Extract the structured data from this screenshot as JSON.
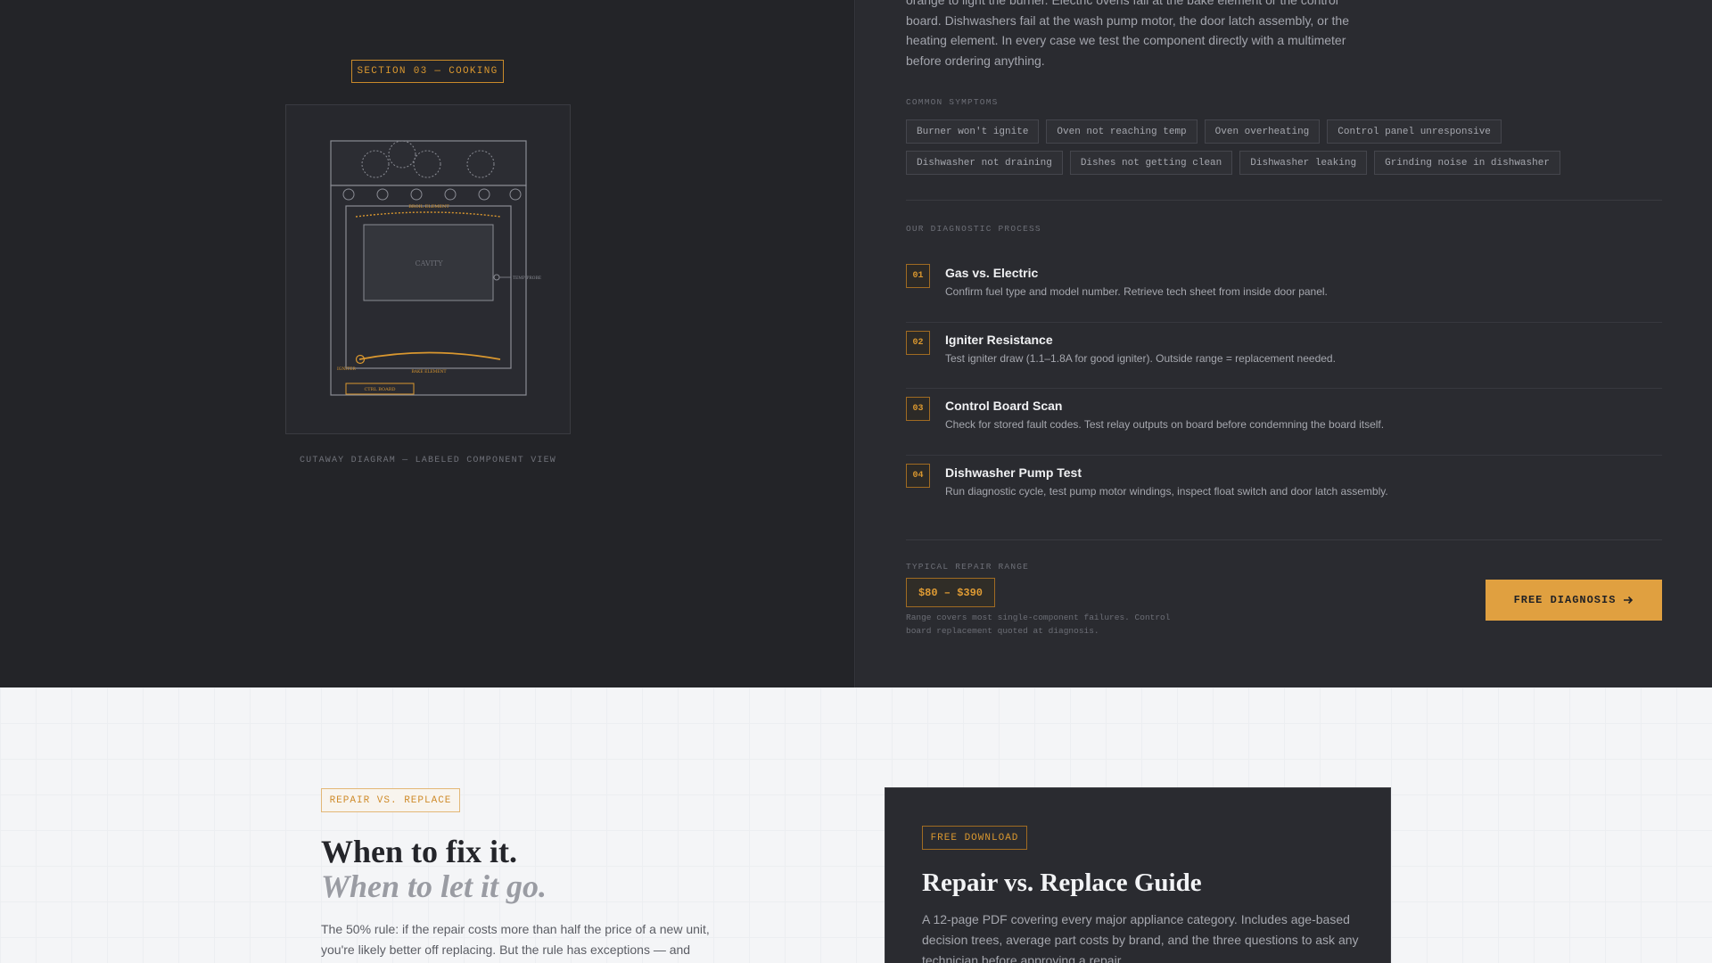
{
  "colors": {
    "accent": "#e0a040",
    "dark_bg": "#27282d",
    "light_bg": "#f4f5f7"
  },
  "left": {
    "section_badge": "SECTION 03 — COOKING",
    "diagram": {
      "cavity": "CAVITY",
      "broil": "BROIL ELEMENT",
      "temp_probe": "TEMP PROBE",
      "igniter": "IGNITER",
      "bake": "BAKE ELEMENT",
      "ctrl": "CTRL BOARD"
    },
    "caption": "CUTAWAY DIAGRAM — LABELED COMPONENT VIEW"
  },
  "right": {
    "intro": "orange to light the burner. Electric ovens fail at the bake element or the control board. Dishwashers fail at the wash pump motor, the door latch assembly, or the heating element. In every case we test the component directly with a multimeter before ordering anything.",
    "symptoms_label": "COMMON SYMPTOMS",
    "symptoms": [
      "Burner won't ignite",
      "Oven not reaching temp",
      "Oven overheating",
      "Control panel unresponsive",
      "Dishwasher not draining",
      "Dishes not getting clean",
      "Dishwasher leaking",
      "Grinding noise in dishwasher"
    ],
    "process_label": "OUR DIAGNOSTIC PROCESS",
    "steps": [
      {
        "num": "01",
        "title": "Gas vs. Electric",
        "desc": "Confirm fuel type and model number. Retrieve tech sheet from inside door panel."
      },
      {
        "num": "02",
        "title": "Igniter Resistance",
        "desc": "Test igniter draw (1.1–1.8A for good igniter). Outside range = replacement needed."
      },
      {
        "num": "03",
        "title": "Control Board Scan",
        "desc": "Check for stored fault codes. Test relay outputs on board before condemning the board itself."
      },
      {
        "num": "04",
        "title": "Dishwasher Pump Test",
        "desc": "Run diagnostic cycle, test pump motor windings, inspect float switch and door latch assembly."
      }
    ],
    "range_label": "TYPICAL REPAIR RANGE",
    "price": "$80 – $390",
    "price_note": "Range covers most single-component failures. Control board replacement quoted at diagnosis.",
    "cta": "FREE DIAGNOSIS",
    "cta_icon": "arrow-right-icon"
  },
  "lower": {
    "tag": "REPAIR VS. REPLACE",
    "heading_main": "When to fix it.",
    "heading_italic": "When to let it go.",
    "body": "The 50% rule: if the repair costs more than half the price of a new unit, you're likely better off replacing. But the rule has exceptions — and",
    "card": {
      "tag": "FREE DOWNLOAD",
      "title": "Repair vs. Replace Guide",
      "desc": "A 12-page PDF covering every major appliance category. Includes age-based decision trees, average part costs by brand, and the three questions to ask any technician before approving a repair."
    }
  }
}
